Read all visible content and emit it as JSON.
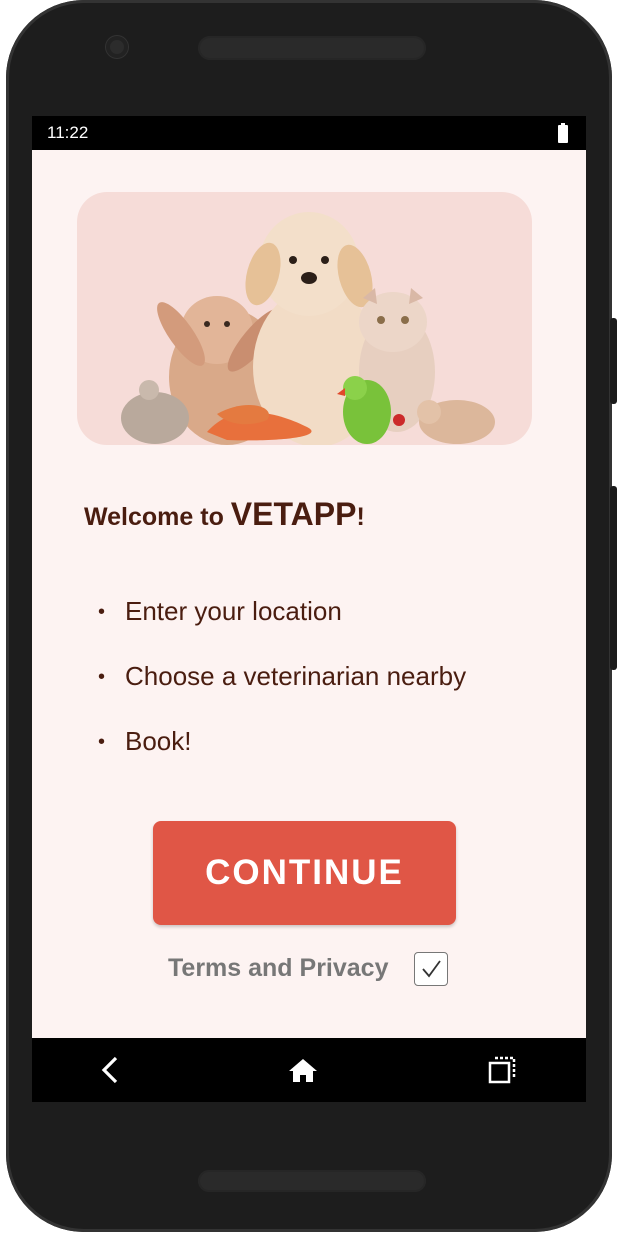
{
  "status_bar": {
    "time": "11:22",
    "battery_icon": "battery-icon"
  },
  "hero": {
    "icon": "pets-illustration"
  },
  "welcome": {
    "prefix": "Welcome to ",
    "app_name": "VETAPP",
    "suffix": "!"
  },
  "steps": [
    {
      "bullet": "•",
      "text": "Enter your location"
    },
    {
      "bullet": "•",
      "text": "Choose a veterinarian nearby"
    },
    {
      "bullet": "•",
      "text": "Book!"
    }
  ],
  "continue_button": {
    "label": "CONTINUE"
  },
  "terms": {
    "label": "Terms and Privacy",
    "checked": true
  },
  "nav_bar": {
    "back_icon": "back-icon",
    "home_icon": "home-icon",
    "recents_icon": "recents-icon"
  },
  "colors": {
    "accent": "#e05646",
    "background": "#fdf3f2",
    "hero_background": "#f6dcd8",
    "text": "#4a1d10",
    "muted_text": "#777777"
  }
}
